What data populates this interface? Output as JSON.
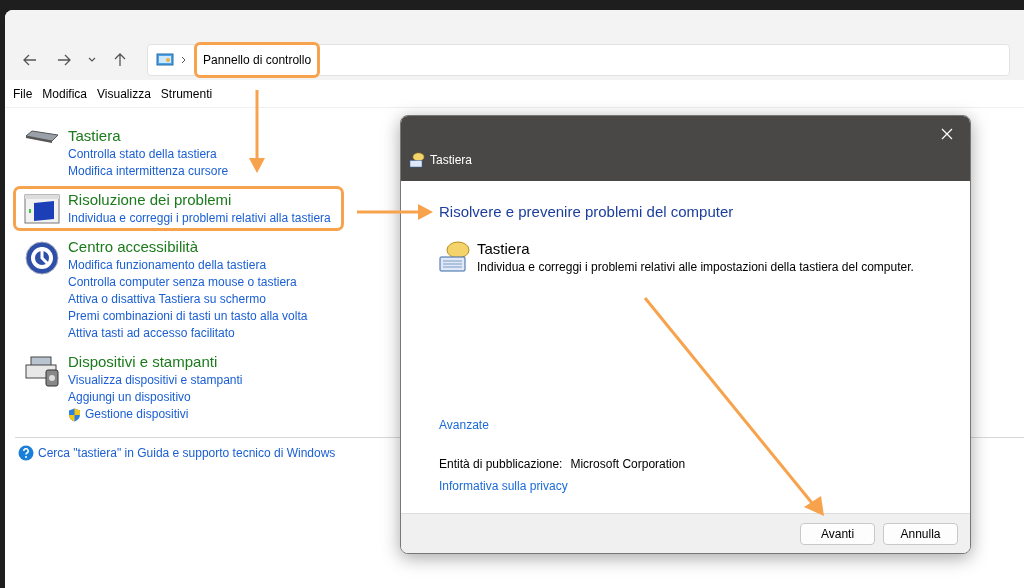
{
  "address": {
    "path": "Pannello di controllo",
    "highlighted": true
  },
  "menu": [
    "File",
    "Modifica",
    "Visualizza",
    "Strumenti"
  ],
  "sections": [
    {
      "kind": "keyboard",
      "title": "Tastiera",
      "highlighted": false,
      "links": [
        {
          "text": "Controlla stato della tastiera",
          "shield": false
        },
        {
          "text": "Modifica intermittenza cursore",
          "shield": false
        }
      ]
    },
    {
      "kind": "troubleshoot",
      "title": "Risoluzione dei problemi",
      "highlighted": true,
      "links": [
        {
          "text": "Individua e correggi i problemi relativi alla tastiera",
          "shield": false
        }
      ]
    },
    {
      "kind": "accessibility",
      "title": "Centro accessibilità",
      "highlighted": false,
      "links": [
        {
          "text": "Modifica funzionamento della tastiera",
          "shield": false
        },
        {
          "text": "Controlla computer senza mouse o tastiera",
          "shield": false
        },
        {
          "text": "Attiva o disattiva Tastiera su schermo",
          "shield": false
        },
        {
          "text": "Premi combinazioni di tasti un tasto alla volta",
          "shield": false
        },
        {
          "text": "Attiva tasti ad accesso facilitato",
          "shield": false
        }
      ]
    },
    {
      "kind": "devices",
      "title": "Dispositivi e stampanti",
      "highlighted": false,
      "links": [
        {
          "text": "Visualizza dispositivi e stampanti",
          "shield": false
        },
        {
          "text": "Aggiungi un dispositivo",
          "shield": false
        },
        {
          "text": "Gestione dispositivi",
          "shield": true
        }
      ]
    }
  ],
  "help_link": "Cerca \"tastiera\" in Guida e supporto tecnico di Windows",
  "dialog": {
    "title": "Tastiera",
    "heading": "Risolvere e prevenire problemi del computer",
    "item": {
      "title": "Tastiera",
      "description": "Individua e correggi i problemi relativi alle impostazioni della tastiera del computer."
    },
    "advanced_link": "Avanzate",
    "publisher_label": "Entità di pubblicazione:",
    "publisher": "Microsoft Corporation",
    "privacy_link": "Informativa sulla privacy",
    "buttons": [
      "Avanti",
      "Annulla"
    ]
  }
}
